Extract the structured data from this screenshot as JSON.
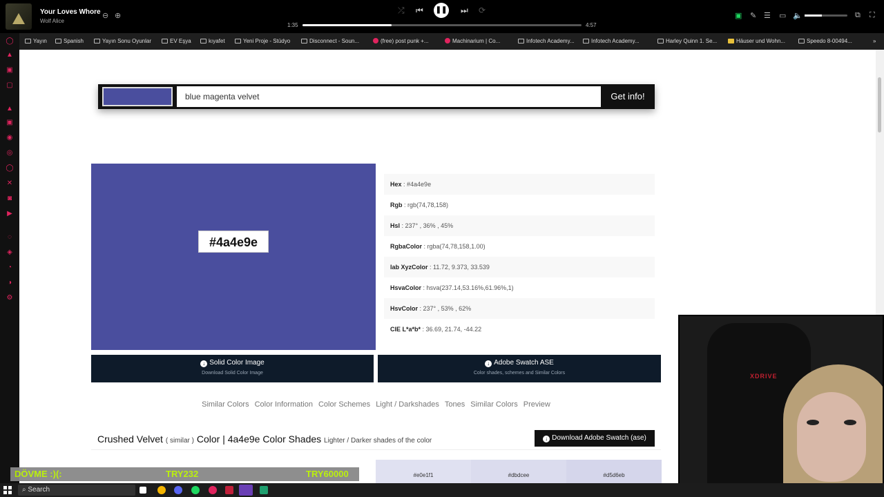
{
  "spotify": {
    "track_title": "Your Loves Whore",
    "artist": "Wolf Alice",
    "elapsed": "1:35",
    "duration": "4:57",
    "progress_fraction": 0.32,
    "volume_fraction": 0.4
  },
  "bookmarks": [
    {
      "label": "Yayın",
      "icon": "folder-icon"
    },
    {
      "label": "Spanish",
      "icon": "folder-icon"
    },
    {
      "label": "Yayın Sonu Oyunlar",
      "icon": "folder-icon"
    },
    {
      "label": "EV Eşya",
      "icon": "folder-icon"
    },
    {
      "label": "kıyafet",
      "icon": "folder-icon"
    },
    {
      "label": "Yeni Proje - Stüdyo",
      "icon": "site-icon"
    },
    {
      "label": "Disconnect - Soun...",
      "icon": "soundcloud-icon"
    },
    {
      "label": "(free) post punk +...",
      "icon": "youtube-icon"
    },
    {
      "label": "Machinarium | Co...",
      "icon": "youtube-icon"
    },
    {
      "label": "Infotech Academy...",
      "icon": "site-icon"
    },
    {
      "label": "Infotech Academy...",
      "icon": "site-icon"
    },
    {
      "label": "Harley Quinn 1. Se...",
      "icon": "site-icon"
    },
    {
      "label": "Häuser und Wohn...",
      "icon": "site-icon"
    },
    {
      "label": "Speedo 8-00494...",
      "icon": "site-icon"
    }
  ],
  "search": {
    "value": "blue magenta velvet",
    "button_label": "Get info!",
    "swatch_color": "#4a4e9e"
  },
  "color": {
    "hex_label": "#4a4e9e",
    "swatch": "#4a4e9e",
    "info": [
      {
        "key": "Hex",
        "value": "#4a4e9e"
      },
      {
        "key": "Rgb",
        "value": "rgb(74,78,158)"
      },
      {
        "key": "Hsl",
        "value": "237° , 36% , 45%"
      },
      {
        "key": "RgbaColor",
        "value": "rgba(74,78,158,1.00)"
      },
      {
        "key": "lab XyzColor",
        "value": "11.72, 9.373, 33.539"
      },
      {
        "key": "HsvaColor",
        "value": "hsva(237.14,53.16%,61.96%,1)"
      },
      {
        "key": "HsvColor",
        "value": "237° , 53% , 62%"
      },
      {
        "key": "CIE L*a*b*",
        "value": "36.69, 21.74, -44.22"
      }
    ]
  },
  "downloads": {
    "solid": {
      "title": "Solid Color Image",
      "subtitle": "Download Solid Color Image"
    },
    "ase": {
      "title": "Adobe Swatch ASE",
      "subtitle": "Color shades, schemes and Similar Colors"
    }
  },
  "tabs": [
    "Similar Colors",
    "Color Information",
    "Color Schemes",
    "Light / Darkshades",
    "Tones",
    "Similar Colors",
    "Preview"
  ],
  "shades": {
    "title_main": "Crushed Velvet",
    "title_similar": "( similar )",
    "title_rest": "Color | 4a4e9e Color Shades",
    "title_sub": "Lighter / Darker shades of the color",
    "download_label": "Download Adobe Swatch (ase)",
    "cells": [
      {
        "label": "#e0e1f1",
        "color": "#e0e1f1"
      },
      {
        "label": "#dbdcee",
        "color": "#dbdcee"
      },
      {
        "label": "#d5d6eb",
        "color": "#d5d6eb"
      }
    ]
  },
  "donation": {
    "message": "DÖVME :)(:",
    "amount": "TRY232",
    "goal": "TRY60000"
  },
  "webcam": {
    "chair_brand": "XDRIVE"
  },
  "taskbar": {
    "search_label": "Search"
  }
}
